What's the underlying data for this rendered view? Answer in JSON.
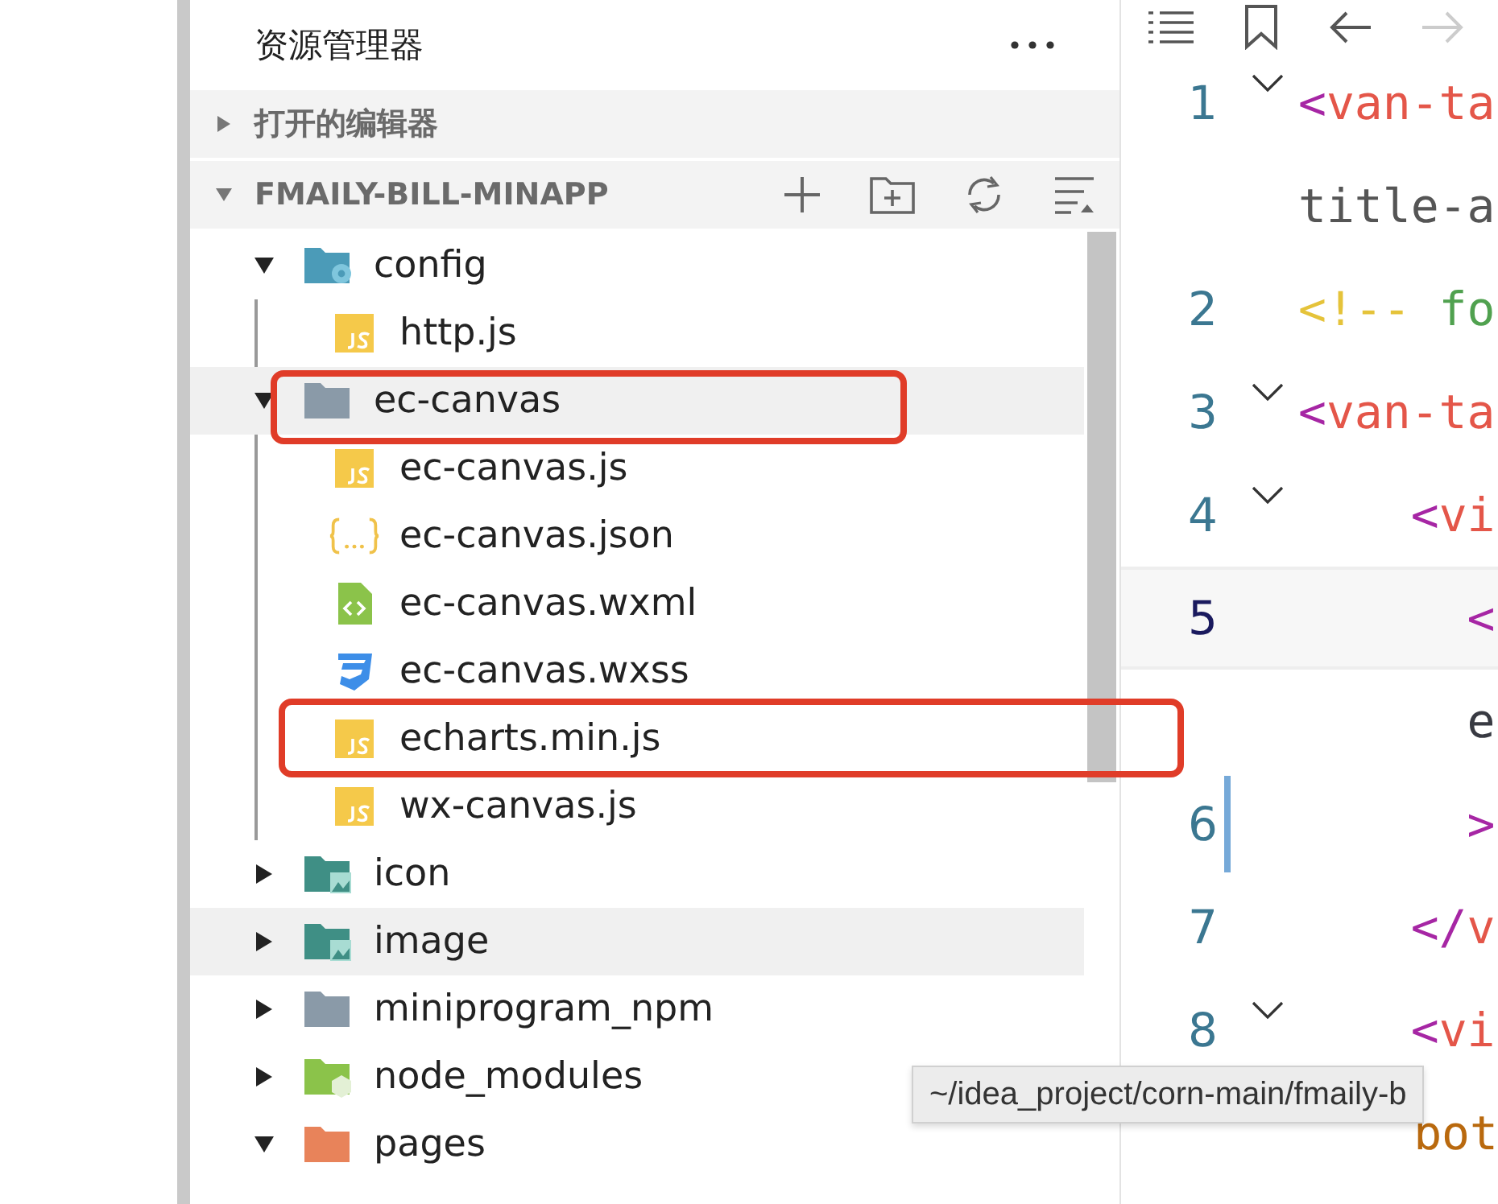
{
  "sidebar": {
    "title": "资源管理器",
    "sections": [
      {
        "title": "打开的编辑器",
        "expanded": false
      },
      {
        "title": "FMAILY-BILL-MINAPP",
        "expanded": true
      }
    ],
    "tree": [
      {
        "name": "config",
        "kind": "config",
        "expanded": true,
        "selected": false,
        "annotated": false,
        "children": [
          {
            "name": "http.js",
            "kind": "js",
            "selected": false,
            "annotated": false
          }
        ]
      },
      {
        "name": "ec-canvas",
        "kind": "folder",
        "expanded": true,
        "selected": true,
        "annotated": true,
        "children": [
          {
            "name": "ec-canvas.js",
            "kind": "js",
            "selected": false,
            "annotated": false
          },
          {
            "name": "ec-canvas.json",
            "kind": "json",
            "selected": false,
            "annotated": false
          },
          {
            "name": "ec-canvas.wxml",
            "kind": "wxml",
            "selected": false,
            "annotated": false
          },
          {
            "name": "ec-canvas.wxss",
            "kind": "wxss",
            "selected": false,
            "annotated": false
          },
          {
            "name": "echarts.min.js",
            "kind": "js",
            "selected": false,
            "annotated": true
          },
          {
            "name": "wx-canvas.js",
            "kind": "js",
            "selected": false,
            "annotated": false
          }
        ]
      },
      {
        "name": "icon",
        "kind": "assets",
        "expanded": false,
        "selected": false,
        "annotated": false
      },
      {
        "name": "image",
        "kind": "assets",
        "expanded": false,
        "selected": true,
        "annotated": false
      },
      {
        "name": "miniprogram_npm",
        "kind": "folder",
        "expanded": false,
        "selected": false,
        "annotated": false
      },
      {
        "name": "node_modules",
        "kind": "modules",
        "expanded": false,
        "selected": false,
        "annotated": false
      },
      {
        "name": "pages",
        "kind": "pages",
        "expanded": true,
        "selected": false,
        "annotated": false
      }
    ]
  },
  "editor": {
    "lines": [
      {
        "number": "1",
        "fold": true,
        "current": false,
        "modified": false,
        "tokens": [
          {
            "text": "<",
            "kind": "punct"
          },
          {
            "text": "van-ta",
            "kind": "tag"
          }
        ]
      },
      {
        "fold": false,
        "current": false,
        "modified": false,
        "tokens": [
          {
            "text": "title-a",
            "kind": "attr"
          }
        ]
      },
      {
        "number": "2",
        "fold": false,
        "current": false,
        "modified": false,
        "tokens": [
          {
            "text": "<!--",
            "kind": "comment-mark"
          },
          {
            "text": " fo",
            "kind": "comment"
          }
        ]
      },
      {
        "number": "3",
        "fold": true,
        "current": false,
        "modified": false,
        "tokens": [
          {
            "text": "<",
            "kind": "punct"
          },
          {
            "text": "van-ta",
            "kind": "tag"
          }
        ]
      },
      {
        "number": "4",
        "fold": true,
        "current": false,
        "modified": false,
        "tokens": [
          {
            "text": "    <",
            "kind": "punct"
          },
          {
            "text": "vi",
            "kind": "tag"
          }
        ]
      },
      {
        "number": "5",
        "fold": false,
        "current": true,
        "modified": false,
        "tokens": [
          {
            "text": "      <",
            "kind": "punct"
          }
        ]
      },
      {
        "fold": false,
        "current": false,
        "modified": false,
        "tokens": [
          {
            "text": "      e",
            "kind": "text"
          }
        ]
      },
      {
        "number": "6",
        "fold": false,
        "current": false,
        "modified": true,
        "tokens": [
          {
            "text": "      >",
            "kind": "punct"
          }
        ]
      },
      {
        "number": "7",
        "fold": false,
        "current": false,
        "modified": false,
        "tokens": [
          {
            "text": "    </",
            "kind": "punct"
          },
          {
            "text": "v",
            "kind": "tag"
          }
        ]
      },
      {
        "number": "8",
        "fold": true,
        "current": false,
        "modified": false,
        "tokens": [
          {
            "text": "    <",
            "kind": "punct"
          },
          {
            "text": "vi",
            "kind": "tag"
          }
        ]
      },
      {
        "fold": false,
        "current": false,
        "modified": false,
        "tokens": [
          {
            "text": "     bot",
            "kind": "attr-name"
          }
        ]
      }
    ]
  },
  "tooltip": {
    "text": "~/idea_project/corn-main/fmaily-b"
  }
}
